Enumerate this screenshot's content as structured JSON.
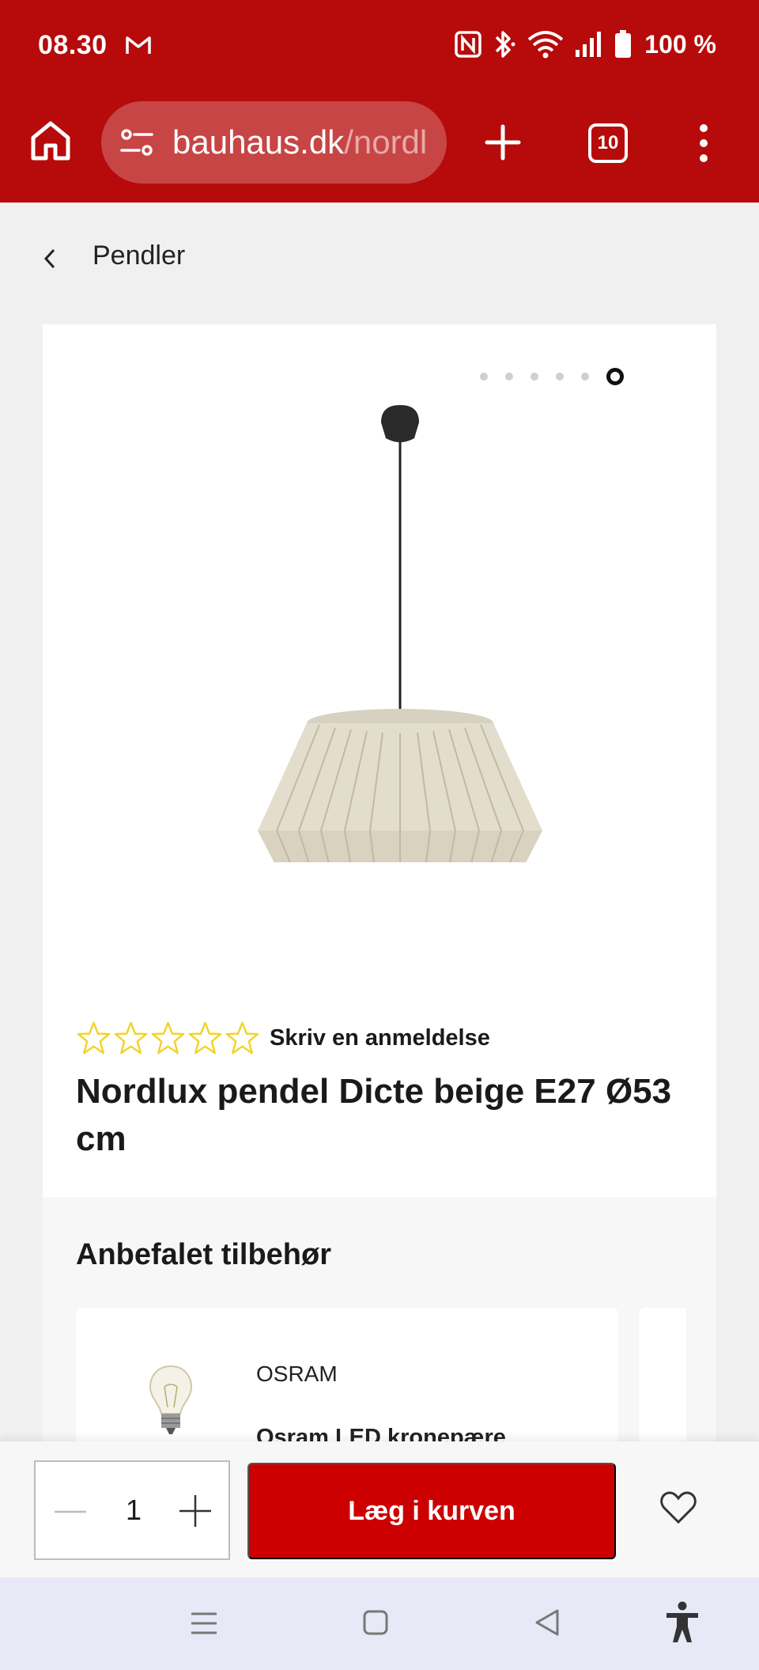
{
  "status_bar": {
    "time": "08.30",
    "battery": "100 %"
  },
  "browser": {
    "url_domain": "bauhaus.dk",
    "url_path": "/nordl",
    "tab_count": "10"
  },
  "breadcrumb": {
    "label": "Pendler"
  },
  "gallery": {
    "slide_count": 6,
    "active_slide": 6
  },
  "product": {
    "rating_stars": 0,
    "review_link": "Skriv en anmeldelse",
    "title": "Nordlux pendel Dicte beige E27 Ø53 cm"
  },
  "accessories": {
    "heading": "Anbefalet tilbehør",
    "items": [
      {
        "brand": "OSRAM",
        "name": "Osram LED kronepære"
      }
    ]
  },
  "buy_bar": {
    "quantity": "1",
    "add_to_cart": "Læg i kurven"
  },
  "colors": {
    "brand_red": "#b70a0a",
    "button_red": "#cc0000",
    "star_yellow": "#f2d32b"
  }
}
